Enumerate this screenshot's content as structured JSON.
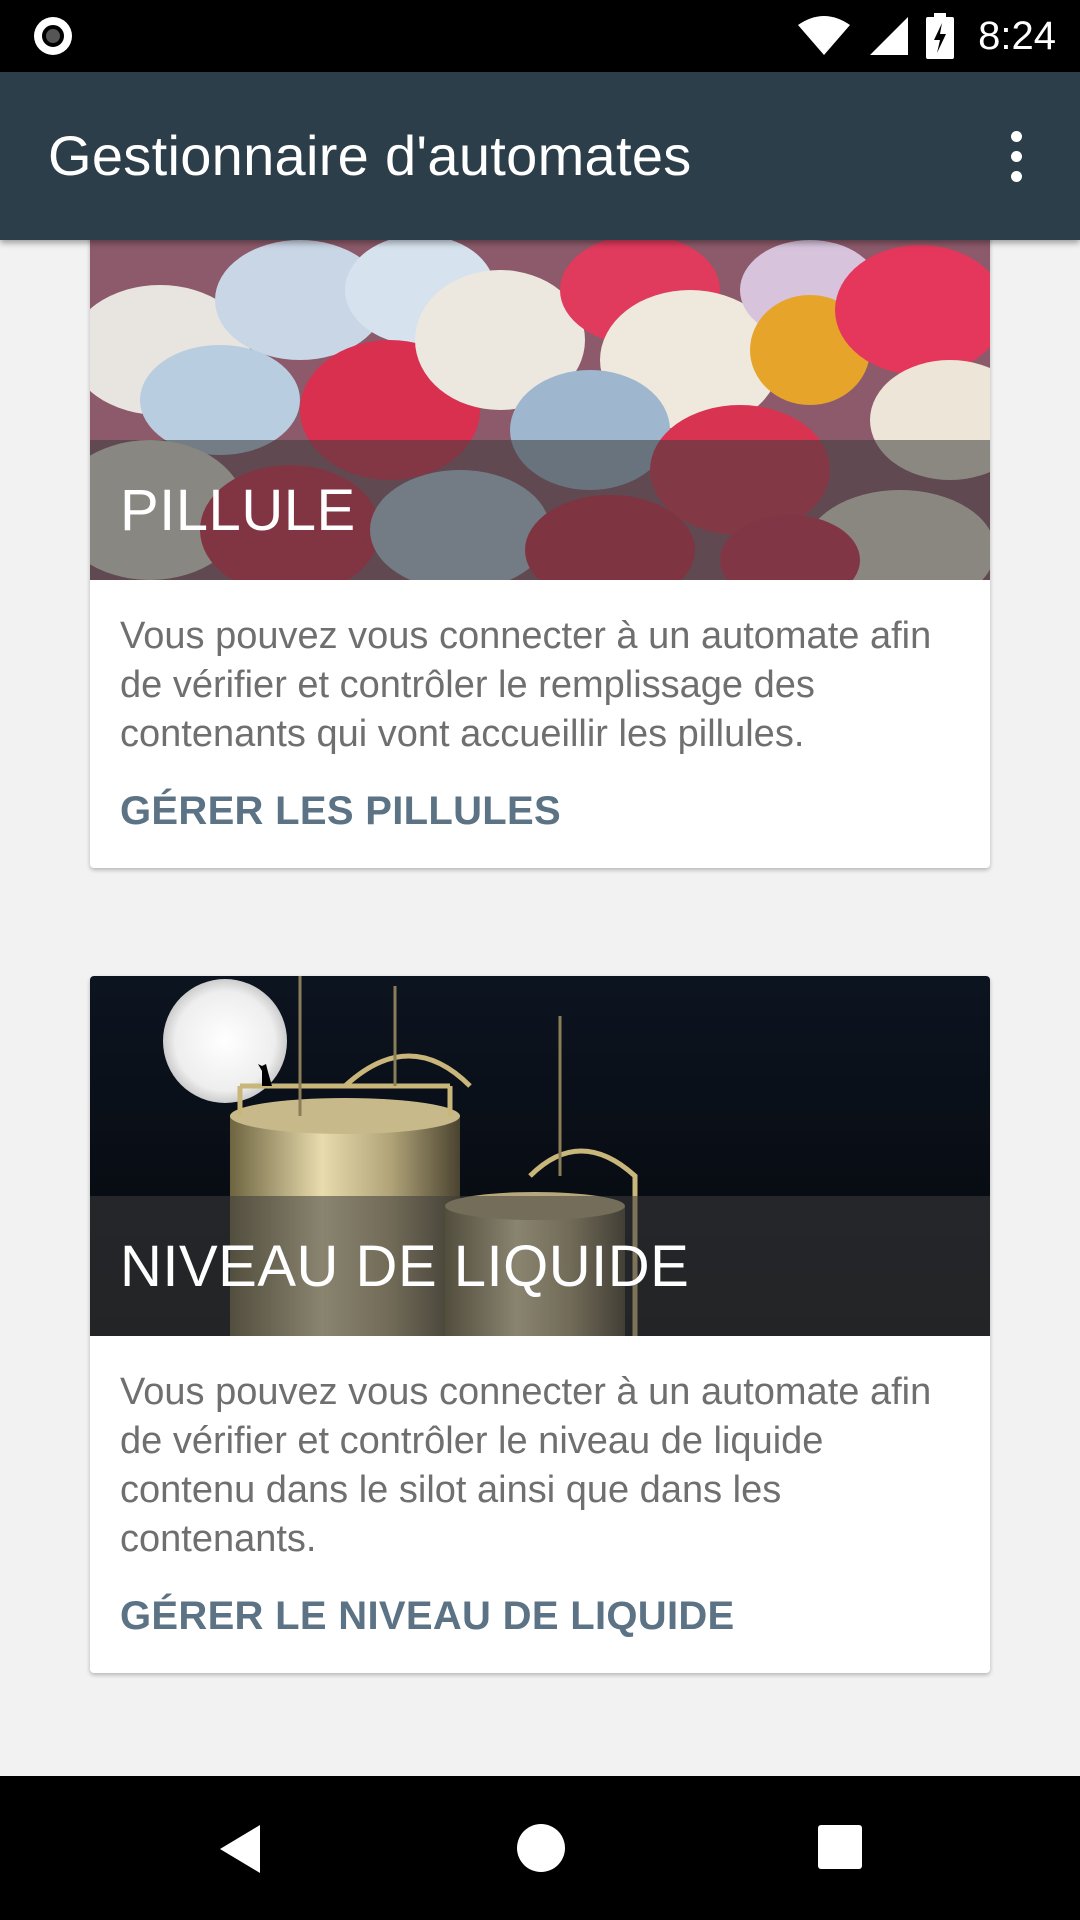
{
  "status_bar": {
    "time": "8:24",
    "icons": [
      "record-icon",
      "wifi-icon",
      "signal-icon",
      "battery-charging-icon"
    ]
  },
  "app_bar": {
    "title": "Gestionnaire d'automates",
    "menu_icon": "more-vert-icon"
  },
  "cards": [
    {
      "title": "PILLULE",
      "description": "Vous pouvez vous connecter à un automate afin de vérifier et contrôler le remplissage des contenants qui vont accueillir les pillules.",
      "action": "GÉRER LES PILLULES"
    },
    {
      "title": "NIVEAU DE LIQUIDE",
      "description": "Vous pouvez vous connecter à un automate afin de vérifier et contrôler le niveau de liquide contenu dans le silot ainsi que dans les contenants.",
      "action": "GÉRER LE NIVEAU DE LIQUIDE"
    }
  ],
  "nav_bar": {
    "icons": [
      "back-icon",
      "home-icon",
      "recents-icon"
    ]
  },
  "colors": {
    "app_bar": "#2c3e4a",
    "action_text": "#5b7384",
    "background": "#f2f2f2"
  }
}
